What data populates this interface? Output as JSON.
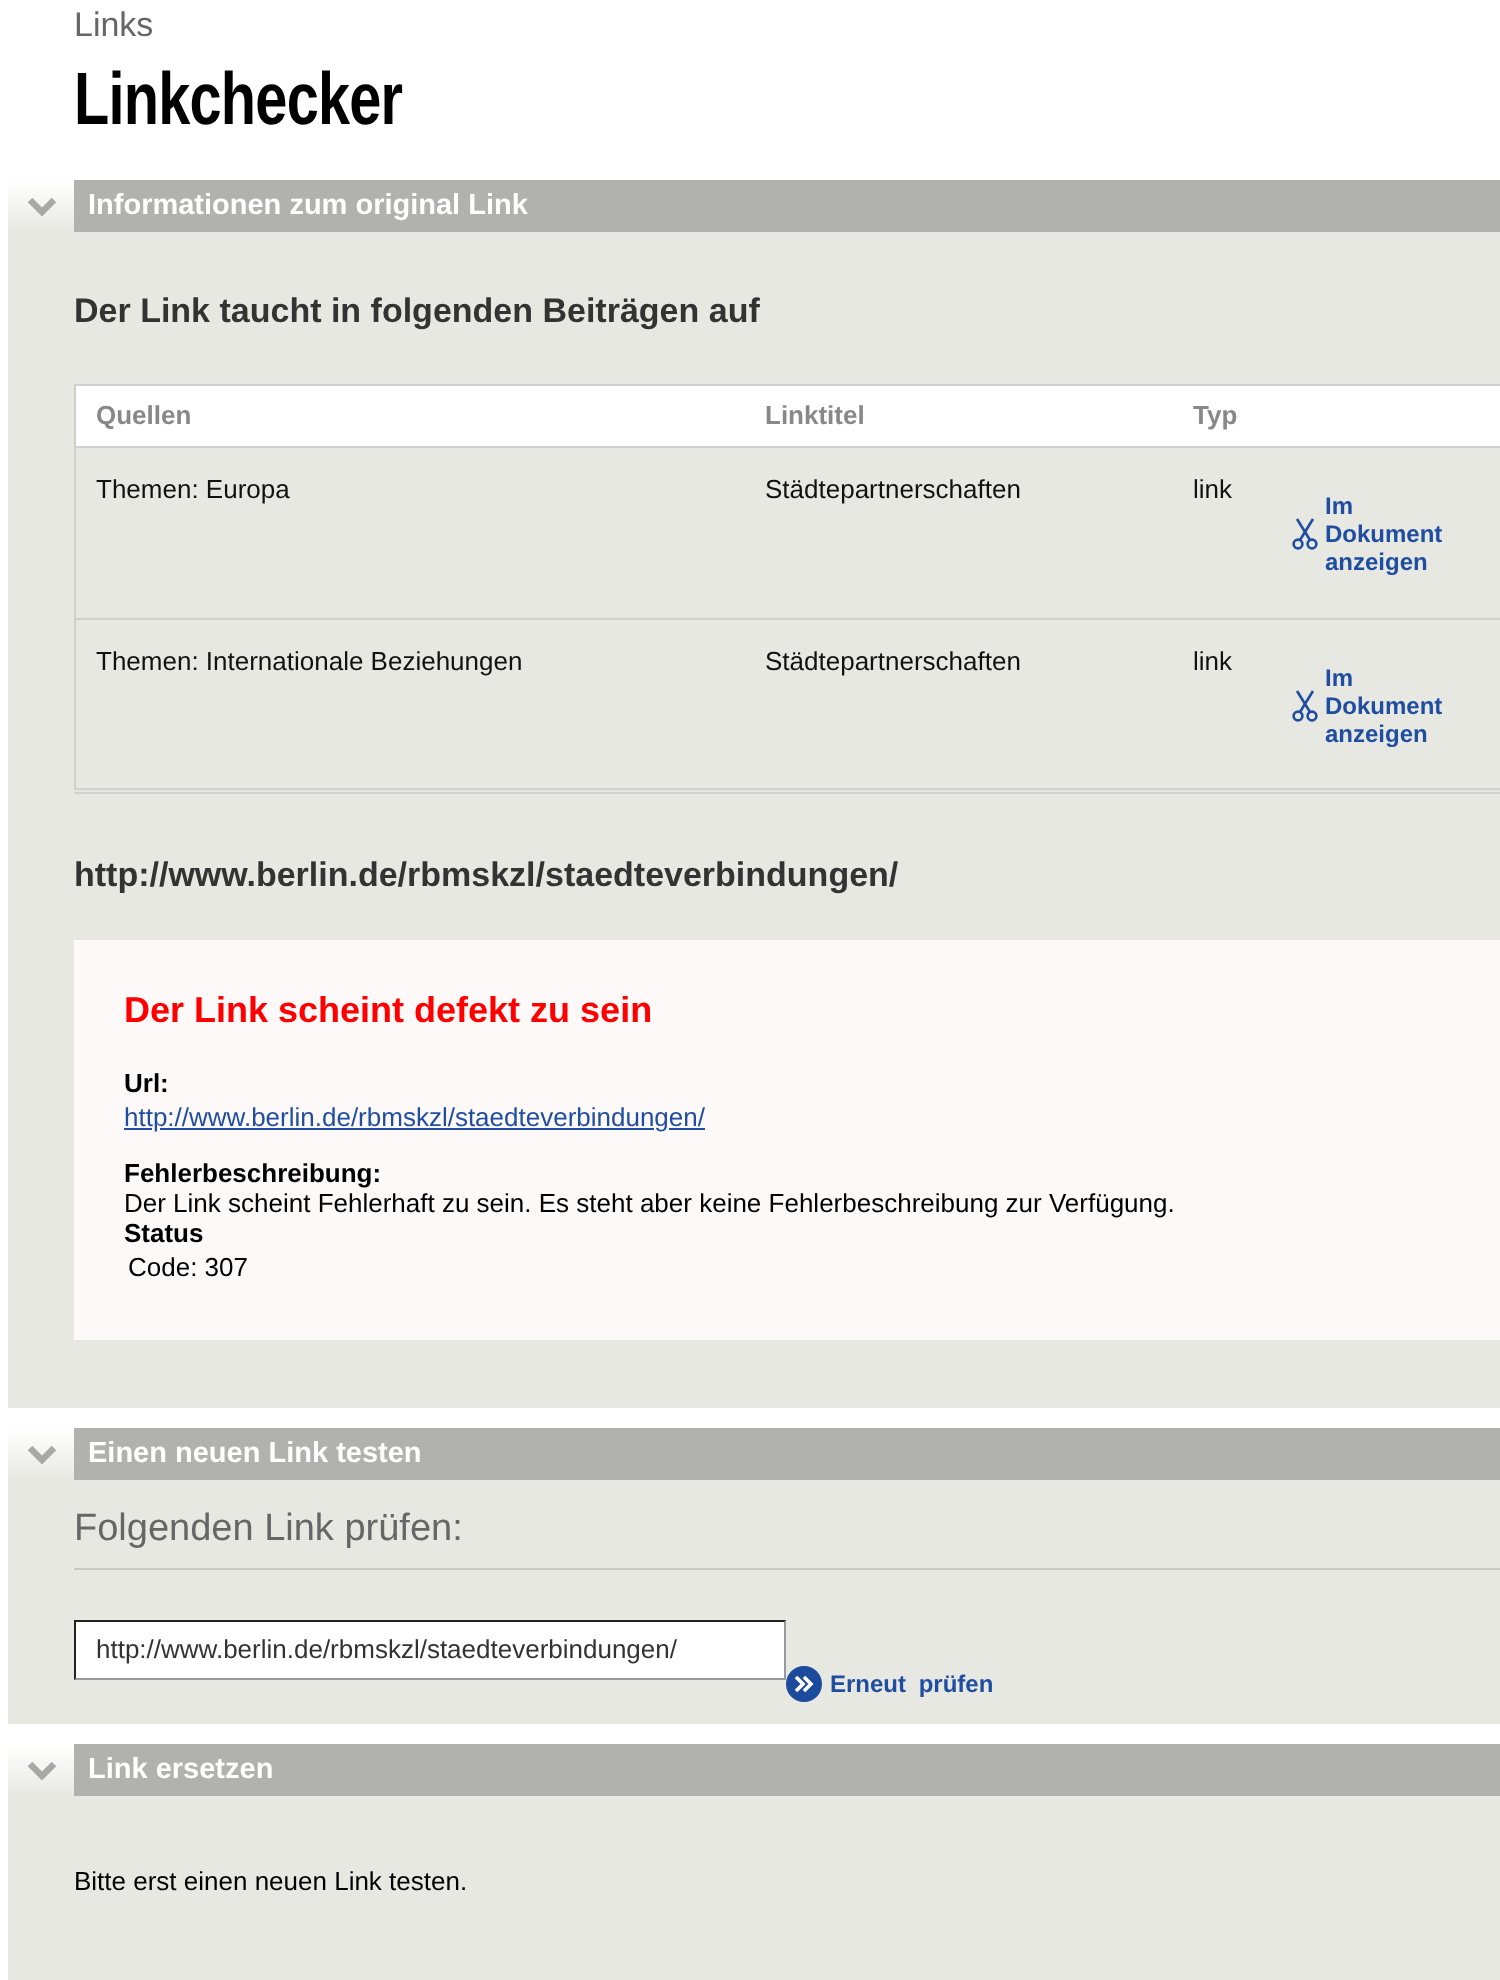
{
  "breadcrumb": "Links",
  "title": "Linkchecker",
  "sections": [
    {
      "kind": "info",
      "title": "Informationen zum original Link",
      "expanded": true,
      "heading": "Der Link taucht in folgenden Beiträgen auf",
      "table": {
        "columns": [
          "Quellen",
          "Linktitel",
          "Typ"
        ],
        "rows": [
          {
            "source": "Themen: Europa",
            "link_title": "Städtepartnerschaften",
            "type": "link",
            "action": "Im Dokument anzeigen"
          },
          {
            "source": "Themen: Internationale Beziehungen",
            "link_title": "Städtepartnerschaften",
            "type": "link",
            "action": "Im Dokument anzeigen"
          }
        ]
      },
      "url_heading": "http://www.berlin.de/rbmskzl/staedteverbindungen/",
      "result": {
        "title": "Der Link scheint defekt zu sein",
        "url_label": "Url:",
        "url": "http://www.berlin.de/rbmskzl/staedteverbindungen/",
        "error_label": "Fehlerbeschreibung:",
        "error_text": "Der Link scheint Fehlerhaft zu sein. Es steht aber keine Fehlerbeschreibung zur Verfügung.",
        "status_label": "Status",
        "status_text": "Code: 307"
      }
    },
    {
      "kind": "test",
      "title": "Einen neuen Link testen",
      "expanded": true,
      "heading": "Folgenden Link prüfen:",
      "input": {
        "value": "http://www.berlin.de/rbmskzl/staedteverbindungen/"
      },
      "button": "Erneut prüfen"
    },
    {
      "kind": "replace",
      "title": "Link ersetzen",
      "expanded": true,
      "message": "Bitte erst einen neuen Link testen."
    }
  ]
}
